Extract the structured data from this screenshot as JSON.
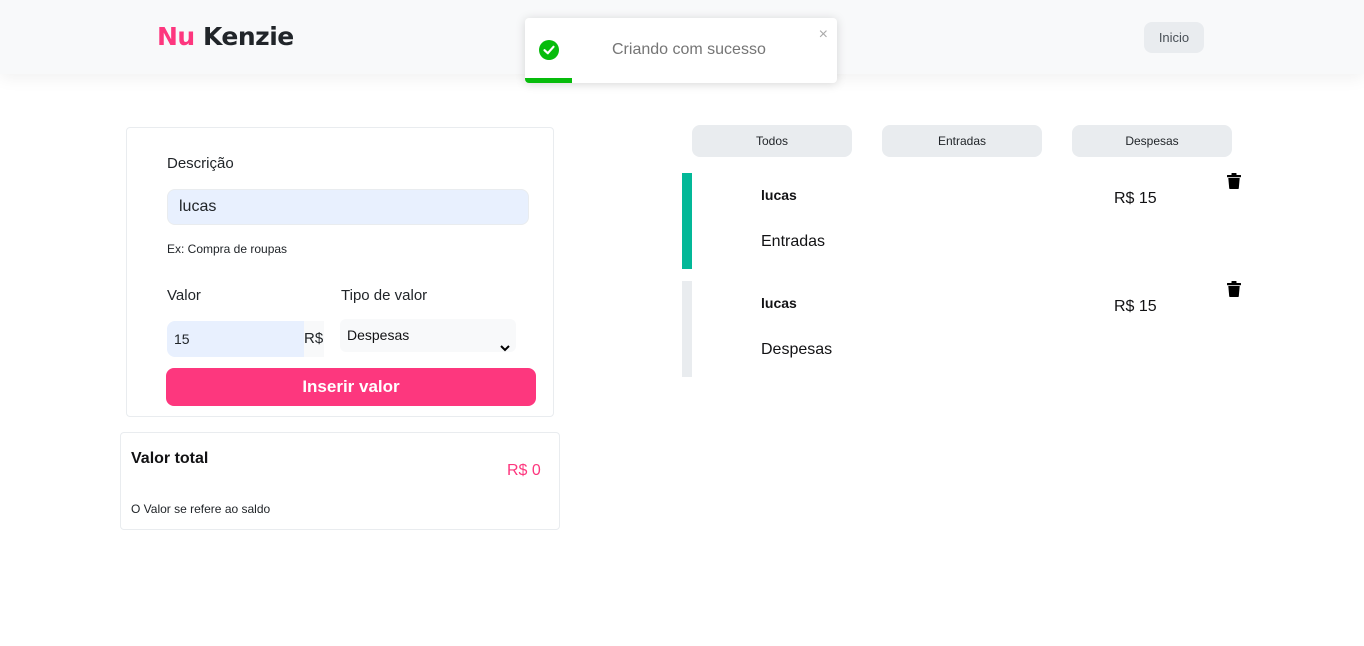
{
  "header": {
    "logo_part1": "Nu",
    "logo_part2": "Kenzie",
    "home_button": "Inicio"
  },
  "toast": {
    "message": "Criando com sucesso",
    "close": "×",
    "progress": 0.15,
    "color": "#07bc0c"
  },
  "form": {
    "description_label": "Descrição",
    "description_value": "lucas",
    "description_hint": "Ex: Compra de roupas",
    "value_label": "Valor",
    "value_value": "15",
    "currency": "R$",
    "type_label": "Tipo de valor",
    "type_selected": "Despesas",
    "submit_label": "Inserir valor"
  },
  "total": {
    "title": "Valor total",
    "value": "R$ 0",
    "note": "O Valor se refere ao saldo"
  },
  "filters": [
    "Todos",
    "Entradas",
    "Despesas"
  ],
  "entries": [
    {
      "name": "lucas",
      "type": "Entradas",
      "amount": "R$ 15",
      "accent": "#03b898",
      "icon": "trash-icon"
    },
    {
      "name": "lucas",
      "type": "Despesas",
      "amount": "R$ 15",
      "accent": "#e9ecef",
      "icon": "trash-icon"
    }
  ],
  "colors": {
    "brand": "#fd377e",
    "income": "#03b898",
    "expense": "#e9ecef"
  }
}
